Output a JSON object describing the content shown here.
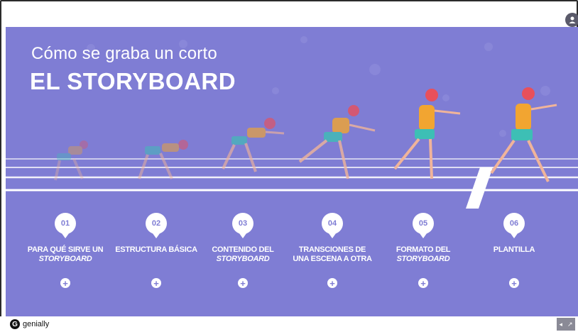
{
  "presentation": {
    "title_line1": "Cómo se graba un corto",
    "title_line2": "EL STORYBOARD"
  },
  "items": [
    {
      "number": "01",
      "label": "PARA QUÉ SIRVE UN",
      "label_italic": "STORYBOARD"
    },
    {
      "number": "02",
      "label": "ESTRUCTURA BÁSICA",
      "label_italic": ""
    },
    {
      "number": "03",
      "label": "CONTENIDO DEL",
      "label_italic": "STORYBOARD"
    },
    {
      "number": "04",
      "label": "TRANSCIONES DE",
      "label_italic_plain": "UNA ESCENA A OTRA"
    },
    {
      "number": "05",
      "label": "FORMATO DEL",
      "label_italic": "STORYBOARD"
    },
    {
      "number": "06",
      "label": "PLANTILLA",
      "label_italic": ""
    }
  ],
  "footer": {
    "brand": "genially",
    "logo_letter": "G"
  },
  "icons": {
    "plus": "plus-circle-icon",
    "share": "share-icon",
    "fullscreen": "expand-icon",
    "corner": "user-circle-icon"
  },
  "colors": {
    "background": "#7f7dd4",
    "runner_shirt": "#f2a531",
    "runner_shorts": "#3dbfb5",
    "runner_hair": "#e8505b"
  }
}
